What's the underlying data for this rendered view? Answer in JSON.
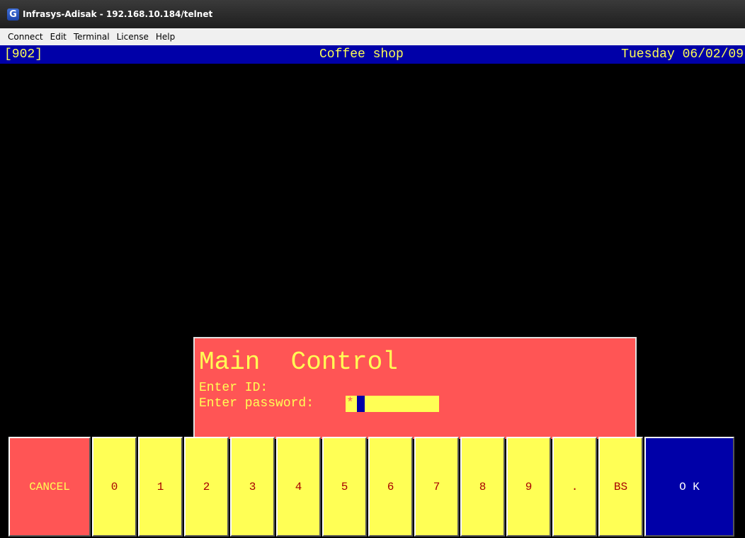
{
  "window": {
    "title": "Infrasys-Adisak - 192.168.10.184/telnet",
    "icon_glyph": "G"
  },
  "menu": [
    "Connect",
    "Edit",
    "Terminal",
    "License",
    "Help"
  ],
  "status": {
    "terminal_id": "[902]",
    "outlet": "Coffee shop",
    "date": "Tuesday 06/02/09"
  },
  "dialog": {
    "title": "Main  Control",
    "id_prompt": "Enter ID:",
    "password_prompt": "Enter password:",
    "password_mask": "*"
  },
  "keypad": {
    "cancel": "CANCEL",
    "digits": [
      "0",
      "1",
      "2",
      "3",
      "4",
      "5",
      "6",
      "7",
      "8",
      "9",
      "."
    ],
    "backspace": "BS",
    "ok": "O K"
  },
  "colors": {
    "terminal_bg": "#000000",
    "status_bg": "#0000a8",
    "status_text": "#ffff55",
    "dialog_bg": "#ff5555",
    "dialog_text": "#ffff55",
    "key_yellow": "#ffff55",
    "key_ok": "#0000a8"
  }
}
